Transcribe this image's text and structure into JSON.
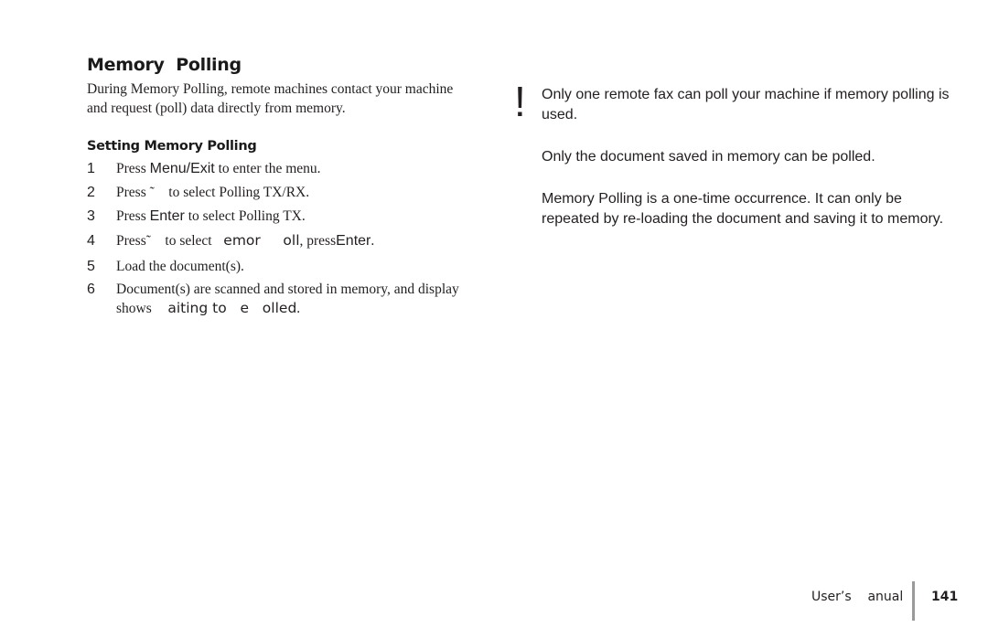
{
  "section": {
    "title": "Memory  Polling",
    "intro": "During Memory Polling, remote machines contact your machine and request (poll) data directly from memory."
  },
  "procedure": {
    "heading": "Setting Memory Polling",
    "steps": [
      {
        "num": "1",
        "pre": "Press ",
        "key": "Menu/Exit",
        "post": " to enter the menu."
      },
      {
        "num": "2",
        "pre": "Press ˜    to select Polling TX/RX.",
        "key": "",
        "post": ""
      },
      {
        "num": "3",
        "pre": "Press ",
        "key": "Enter",
        "post": " to select Polling TX."
      },
      {
        "num": "4",
        "pre": "Press˜    to select  ",
        "lcd": " emor     oll",
        "mid": ", press",
        "key": "Enter",
        "post": "."
      },
      {
        "num": "5",
        "pre": "Load the document(s).",
        "key": "",
        "post": ""
      },
      {
        "num": "6",
        "pre": "Document(s) are scanned and stored in memory, and display shows  ",
        "lcd": "  aiting to   e   olled",
        "post": "."
      }
    ]
  },
  "notes": {
    "icon": "exclamation-icon",
    "icon_glyph": "!",
    "items": [
      "Only one remote fax can poll your machine if memory polling is used.",
      "Only the document saved in memory can be polled.",
      "Memory Polling is a one-time occurrence.  It can only be repeated by re-loading the document and saving it to memory."
    ]
  },
  "footer": {
    "label": "User’s    anual",
    "page_number": "141"
  }
}
